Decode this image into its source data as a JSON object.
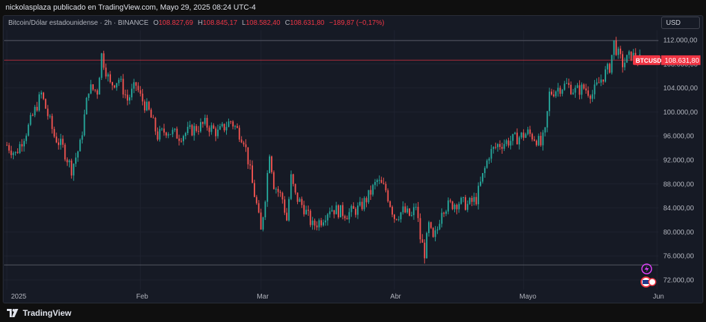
{
  "header": {
    "published": "nickolasplaza publicado en TradingView.com, Mayo 29, 2025 08:24 UTC-4"
  },
  "legend": {
    "symbol": "Bitcoin/Dólar estadounidense · 2h · BINANCE",
    "o_label": "O",
    "o_value": "108.827,69",
    "h_label": "H",
    "h_value": "108.845,17",
    "l_label": "L",
    "l_value": "108.582,40",
    "c_label": "C",
    "c_value": "108.631,80",
    "change": "−189,87 (−0,17%)"
  },
  "currency": "USD",
  "footer": {
    "brand": "TradingView"
  },
  "colors": {
    "up": "#26a69a",
    "down": "#ef5350",
    "price_tag": "#f23645",
    "background": "#161a25",
    "grid": "#2a2e39"
  },
  "chart_data": {
    "type": "candlestick",
    "symbol": "BTCUSD",
    "timeframe": "2h",
    "last_price": 108631.8,
    "last_price_label": "108.631,80",
    "ticker_label": "BTCUSD",
    "ylim": [
      70000,
      114000
    ],
    "y_ticks": [
      {
        "value": 112000,
        "label": "112.000,00"
      },
      {
        "value": 108000,
        "label": "108.000,00"
      },
      {
        "value": 104000,
        "label": "104.000,00"
      },
      {
        "value": 100000,
        "label": "100.000,00"
      },
      {
        "value": 96000,
        "label": "96.000,00"
      },
      {
        "value": 92000,
        "label": "92.000,00"
      },
      {
        "value": 88000,
        "label": "88.000,00"
      },
      {
        "value": 84000,
        "label": "84.000,00"
      },
      {
        "value": 80000,
        "label": "80.000,00"
      },
      {
        "value": 76000,
        "label": "76.000,00"
      },
      {
        "value": 72000,
        "label": "72.000,00"
      }
    ],
    "x_ticks": [
      {
        "day": 0,
        "label": "2025"
      },
      {
        "day": 31,
        "label": "Feb"
      },
      {
        "day": 59,
        "label": "Mar"
      },
      {
        "day": 90,
        "label": "Abr"
      },
      {
        "day": 120,
        "label": "Mayo"
      },
      {
        "day": 151,
        "label": "Jun"
      }
    ],
    "horizontal_lines": [
      111900,
      108631.8,
      74500
    ],
    "price_path": [
      [
        0,
        94500
      ],
      [
        2,
        93000
      ],
      [
        5,
        97500
      ],
      [
        8,
        103000
      ],
      [
        11,
        96000
      ],
      [
        13,
        94000
      ],
      [
        15,
        90500
      ],
      [
        17,
        94500
      ],
      [
        19,
        104000
      ],
      [
        21,
        103500
      ],
      [
        22,
        109500
      ],
      [
        24,
        104500
      ],
      [
        26,
        105500
      ],
      [
        28,
        102000
      ],
      [
        30,
        104500
      ],
      [
        31,
        102500
      ],
      [
        33,
        100000
      ],
      [
        35,
        96000
      ],
      [
        37,
        97000
      ],
      [
        40,
        96000
      ],
      [
        43,
        97000
      ],
      [
        46,
        98000
      ],
      [
        49,
        96500
      ],
      [
        52,
        98500
      ],
      [
        55,
        95500
      ],
      [
        56,
        92000
      ],
      [
        57,
        88000
      ],
      [
        58,
        84500
      ],
      [
        59,
        80000
      ],
      [
        60,
        86000
      ],
      [
        61,
        93500
      ],
      [
        62,
        88000
      ],
      [
        64,
        85500
      ],
      [
        65,
        82000
      ],
      [
        66,
        89000
      ],
      [
        67,
        86000
      ],
      [
        69,
        84000
      ],
      [
        71,
        81000
      ],
      [
        73,
        82000
      ],
      [
        75,
        84000
      ],
      [
        77,
        83500
      ],
      [
        79,
        83000
      ],
      [
        82,
        84000
      ],
      [
        84,
        86000
      ],
      [
        86,
        88500
      ],
      [
        88,
        87000
      ],
      [
        90,
        82500
      ],
      [
        92,
        83500
      ],
      [
        94,
        82500
      ],
      [
        95,
        84500
      ],
      [
        96,
        79000
      ],
      [
        97,
        76500
      ],
      [
        98,
        81000
      ],
      [
        99,
        78500
      ],
      [
        100,
        80500
      ],
      [
        101,
        84000
      ],
      [
        103,
        84500
      ],
      [
        105,
        85000
      ],
      [
        107,
        84500
      ],
      [
        109,
        85500
      ],
      [
        110,
        88000
      ],
      [
        112,
        93000
      ],
      [
        114,
        94500
      ],
      [
        116,
        95000
      ],
      [
        118,
        95500
      ],
      [
        121,
        96500
      ],
      [
        123,
        95500
      ],
      [
        124,
        94500
      ],
      [
        125,
        96500
      ],
      [
        126,
        103000
      ],
      [
        128,
        104000
      ],
      [
        130,
        104500
      ],
      [
        132,
        103500
      ],
      [
        134,
        104000
      ],
      [
        136,
        103000
      ],
      [
        138,
        105500
      ],
      [
        140,
        107500
      ],
      [
        141,
        111500
      ],
      [
        142,
        109500
      ],
      [
        143,
        108000
      ],
      [
        145,
        109500
      ],
      [
        146,
        109000
      ],
      [
        147,
        108631.8
      ]
    ]
  }
}
